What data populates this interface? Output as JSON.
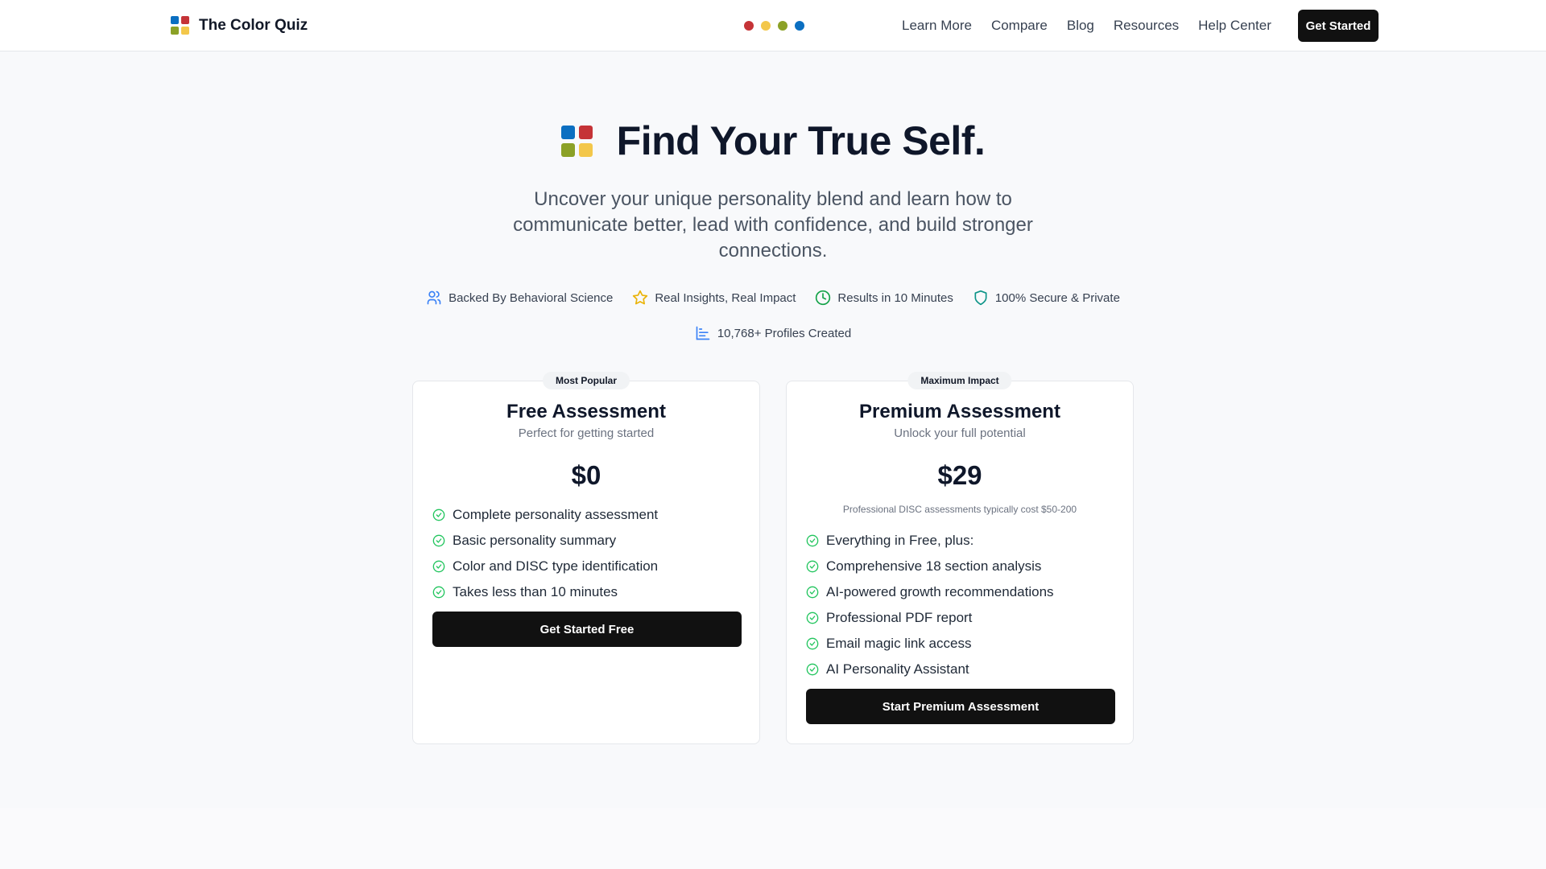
{
  "header": {
    "brand": "The Color Quiz",
    "nav": [
      "Learn More",
      "Compare",
      "Blog",
      "Resources",
      "Help Center"
    ],
    "cta": "Get Started"
  },
  "colors": {
    "blue": "#0b6fc1",
    "red": "#c53337",
    "green": "#8ba126",
    "yellow": "#f3c74a"
  },
  "hero": {
    "title": "Find Your True Self.",
    "subtitle": "Uncover your unique personality blend and learn how to communicate better, lead with confidence, and build stronger connections.",
    "features": [
      {
        "icon": "users-icon",
        "label": "Backed By Behavioral Science"
      },
      {
        "icon": "star-icon",
        "label": "Real Insights, Real Impact"
      },
      {
        "icon": "clock-icon",
        "label": "Results in 10 Minutes"
      },
      {
        "icon": "shield-icon",
        "label": "100% Secure & Private"
      }
    ],
    "profiles": {
      "icon": "bar-chart-icon",
      "label": "10,768+ Profiles Created"
    }
  },
  "plans": {
    "free": {
      "badge": "Most Popular",
      "title": "Free Assessment",
      "tagline": "Perfect for getting started",
      "price": "$0",
      "features": [
        "Complete personality assessment",
        "Basic personality summary",
        "Color and DISC type identification",
        "Takes less than 10 minutes"
      ],
      "button": "Get Started Free"
    },
    "premium": {
      "badge": "Maximum Impact",
      "title": "Premium Assessment",
      "tagline": "Unlock your full potential",
      "price": "$29",
      "note": "Professional DISC assessments typically cost $50-200",
      "features": [
        "Everything in Free, plus:",
        "Comprehensive 18 section analysis",
        "AI-powered growth recommendations",
        "Professional PDF report",
        "Email magic link access",
        "AI Personality Assistant"
      ],
      "button": "Start Premium Assessment"
    }
  }
}
